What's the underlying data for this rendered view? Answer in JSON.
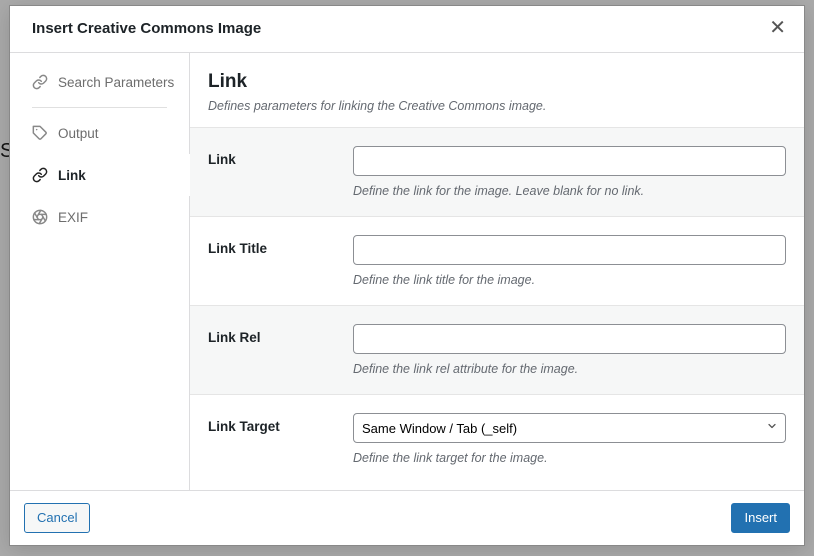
{
  "modal": {
    "title": "Insert Creative Commons Image",
    "sidebar": {
      "items": [
        {
          "label": "Search Parameters"
        },
        {
          "label": "Output"
        },
        {
          "label": "Link"
        },
        {
          "label": "EXIF"
        }
      ]
    },
    "content": {
      "title": "Link",
      "subtitle": "Defines parameters for linking the Creative Commons image.",
      "fields": {
        "link": {
          "label": "Link",
          "value": "",
          "help": "Define the link for the image. Leave blank for no link."
        },
        "link_title": {
          "label": "Link Title",
          "value": "",
          "help": "Define the link title for the image."
        },
        "link_rel": {
          "label": "Link Rel",
          "value": "",
          "help": "Define the link rel attribute for the image."
        },
        "link_target": {
          "label": "Link Target",
          "selected": "Same Window / Tab (_self)",
          "help": "Define the link target for the image."
        }
      }
    },
    "footer": {
      "cancel": "Cancel",
      "insert": "Insert"
    }
  }
}
